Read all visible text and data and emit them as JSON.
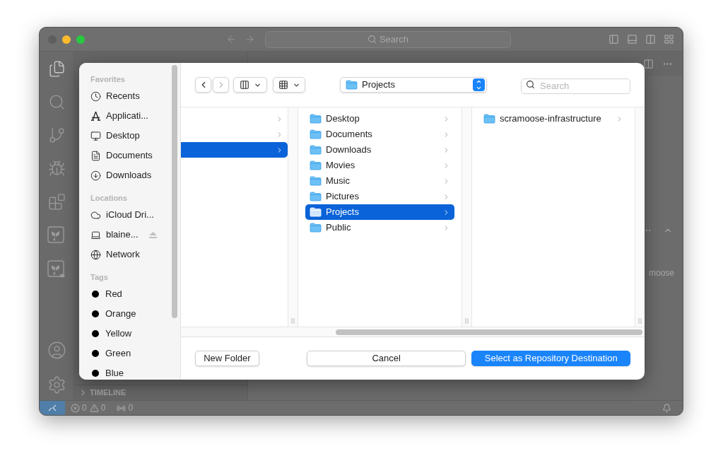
{
  "title_bar": {
    "search": "Search"
  },
  "explorer": {
    "sections": [
      {
        "label": "TIMELINE",
        "expanded": false
      }
    ]
  },
  "editor": {
    "visible_text": "moose"
  },
  "status_bar": {
    "errors": "0",
    "warnings": "0",
    "ports": "0"
  },
  "dialog": {
    "sidebar": [
      {
        "title": "Favorites",
        "items": [
          {
            "label": "Recents",
            "kind": "place"
          },
          {
            "label": "Applicati...",
            "kind": "place"
          },
          {
            "label": "Desktop",
            "kind": "place"
          },
          {
            "label": "Documents",
            "kind": "place"
          },
          {
            "label": "Downloads",
            "kind": "place"
          }
        ]
      },
      {
        "title": "Locations",
        "items": [
          {
            "label": "iCloud Dri...",
            "kind": "place"
          },
          {
            "label": "blaine...",
            "kind": "place",
            "eject": true
          },
          {
            "label": "Network",
            "kind": "place"
          }
        ]
      },
      {
        "title": "Tags",
        "items": [
          {
            "label": "Red",
            "kind": "tag"
          },
          {
            "label": "Orange",
            "kind": "tag"
          },
          {
            "label": "Yellow",
            "kind": "tag"
          },
          {
            "label": "Green",
            "kind": "tag"
          },
          {
            "label": "Blue",
            "kind": "tag"
          }
        ]
      }
    ],
    "nav": {
      "back_disabled": false,
      "forward_disabled": true
    },
    "path": "Projects",
    "search": {
      "placeholder": "Search"
    },
    "columns": [
      {
        "rows": [
          {
            "selected": false
          },
          {
            "selected": false
          },
          {
            "selected": true
          }
        ]
      },
      {
        "rows": [
          {
            "label": "Desktop",
            "selected": false
          },
          {
            "label": "Documents",
            "selected": false
          },
          {
            "label": "Downloads",
            "selected": false
          },
          {
            "label": "Movies",
            "selected": false
          },
          {
            "label": "Music",
            "selected": false
          },
          {
            "label": "Pictures",
            "selected": false
          },
          {
            "label": "Projects",
            "selected": true
          },
          {
            "label": "Public",
            "selected": false
          }
        ]
      },
      {
        "rows": [
          {
            "label": "scramoose-infrastructure",
            "selected": false
          }
        ]
      }
    ],
    "buttons": [
      {
        "label": "New Folder",
        "kind": "secondary"
      },
      {
        "label": "Cancel",
        "kind": "secondary"
      },
      {
        "label": "Select as Repository Destination",
        "kind": "primary"
      }
    ]
  }
}
